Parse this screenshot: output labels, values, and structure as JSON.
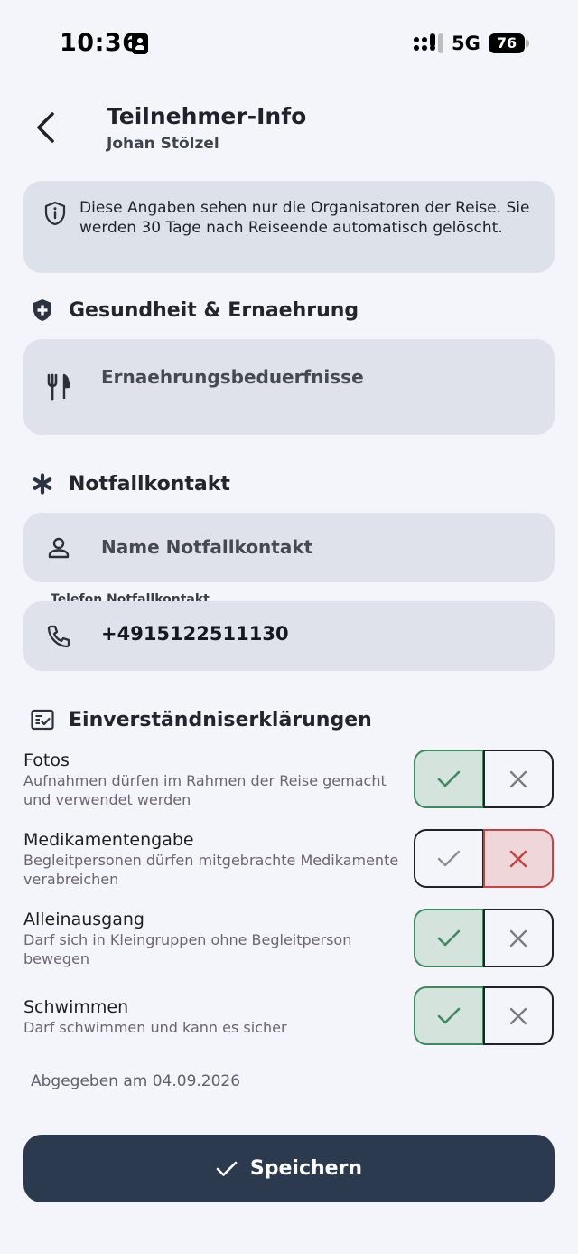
{
  "status_bar": {
    "time": "10:36",
    "network": "5G",
    "battery": "76"
  },
  "header": {
    "title": "Teilnehmer-Info",
    "subtitle": "Johan Stölzel"
  },
  "info": {
    "text": "Diese Angaben sehen nur die Organisatoren der Reise. Sie werden 30 Tage nach Reiseende automatisch gelöscht."
  },
  "health": {
    "title": "Gesundheit & Ernaehrung",
    "diet_placeholder": "Ernaehrungsbeduerfnisse"
  },
  "emergency": {
    "title": "Notfallkontakt",
    "name_placeholder": "Name Notfallkontakt",
    "phone_label": "Telefon Notfallkontakt",
    "phone_value": "+4915122511130"
  },
  "consents": {
    "title": "Einverständniserklärungen",
    "items": [
      {
        "title": "Fotos",
        "description": "Aufnahmen dürfen im Rahmen der Reise gemacht und verwendet werden",
        "value": "yes"
      },
      {
        "title": "Medikamentengabe",
        "description": "Begleitpersonen dürfen mitgebrachte Medikamente verabreichen",
        "value": "no"
      },
      {
        "title": "Alleinausgang",
        "description": "Darf sich in Kleingruppen ohne Begleitperson bewegen",
        "value": "yes"
      },
      {
        "title": "Schwimmen",
        "description": "Darf schwimmen und kann es sicher",
        "value": "yes"
      }
    ]
  },
  "submitted": "Abgegeben am 04.09.2026",
  "save_button": {
    "label": "Speichern"
  },
  "colors": {
    "primary": "#2c3a4f",
    "yes_accent": "#3f8a5d",
    "no_accent": "#c44343",
    "background": "#f4f5fa"
  }
}
